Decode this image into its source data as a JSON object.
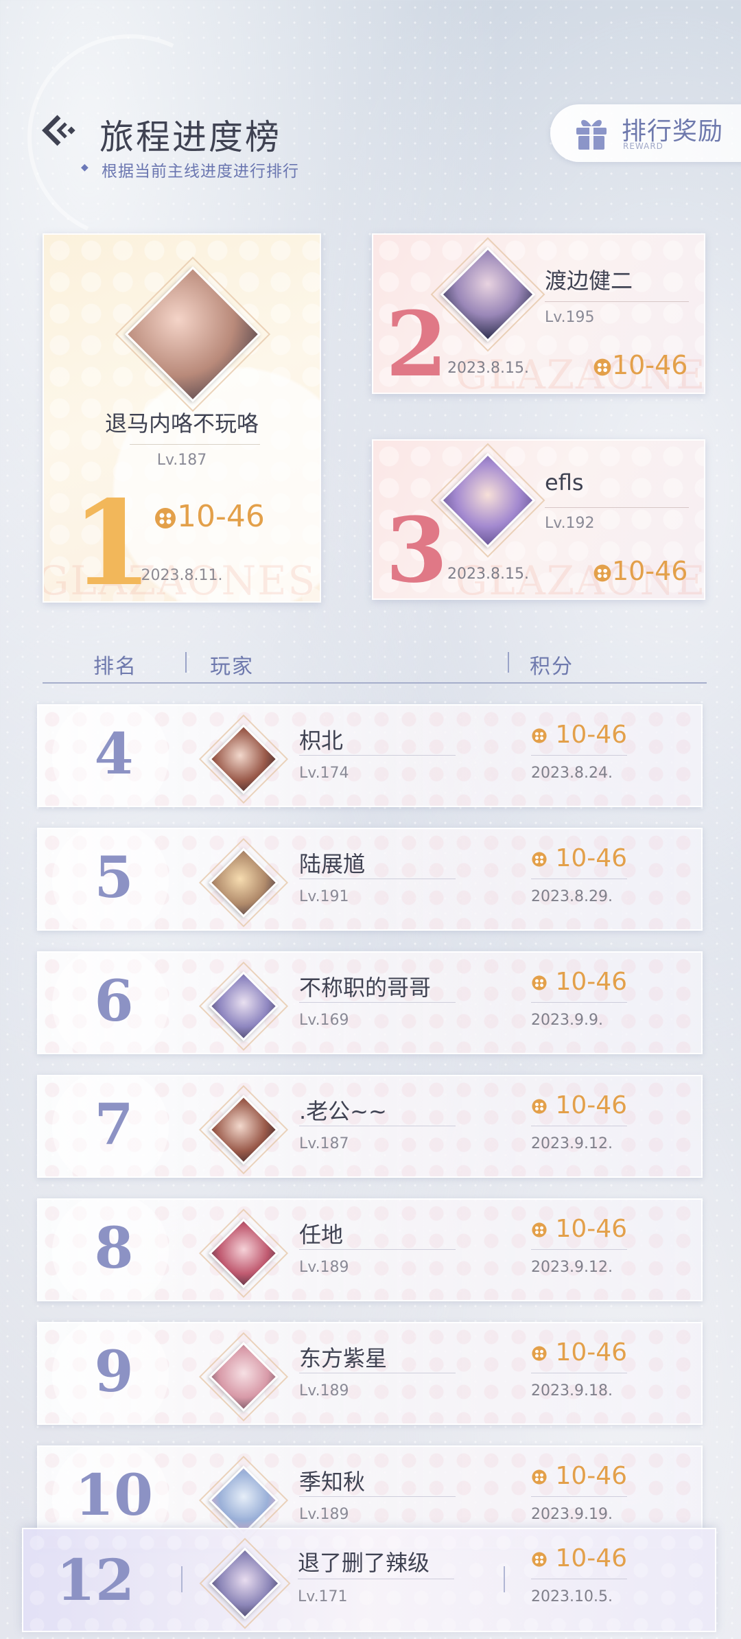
{
  "header": {
    "title": "旅程进度榜",
    "subtitle": "根据当前主线进度进行排行",
    "reward_button": {
      "label": "排行奖励",
      "sublabel": "REWARD"
    }
  },
  "colors": {
    "score": "#e3a04a",
    "rank_top1": "#f2b75a",
    "rank_top23": "#e07886",
    "rank_row": "#8c92c4",
    "accent": "#6e79ad"
  },
  "top3": [
    {
      "rank": "1",
      "name": "退马内咯不玩咯",
      "level": "Lv.187",
      "score": "10-46",
      "date": "2023.8.11.",
      "watermark": "GLAZAONES"
    },
    {
      "rank": "2",
      "name": "渡边健二",
      "level": "Lv.195",
      "score": "10-46",
      "date": "2023.8.15.",
      "watermark": "GLAZAONES"
    },
    {
      "rank": "3",
      "name": "efls",
      "level": "Lv.192",
      "score": "10-46",
      "date": "2023.8.15.",
      "watermark": "GLAZAONES"
    }
  ],
  "table_header": {
    "rank": "排名",
    "player": "玩家",
    "score": "积分"
  },
  "rows": [
    {
      "rank": "4",
      "name": "枳北",
      "level": "Lv.174",
      "score": "10-46",
      "date": "2023.8.24."
    },
    {
      "rank": "5",
      "name": "陆展馗",
      "level": "Lv.191",
      "score": "10-46",
      "date": "2023.8.29."
    },
    {
      "rank": "6",
      "name": "不称职的哥哥",
      "level": "Lv.169",
      "score": "10-46",
      "date": "2023.9.9."
    },
    {
      "rank": "7",
      "name": ".老公~~",
      "level": "Lv.187",
      "score": "10-46",
      "date": "2023.9.12."
    },
    {
      "rank": "8",
      "name": "任地",
      "level": "Lv.189",
      "score": "10-46",
      "date": "2023.9.12."
    },
    {
      "rank": "9",
      "name": "东方紫星",
      "level": "Lv.189",
      "score": "10-46",
      "date": "2023.9.18."
    },
    {
      "rank": "10",
      "name": "季知秋",
      "level": "Lv.189",
      "score": "10-46",
      "date": "2023.9.19."
    }
  ],
  "self_row": {
    "rank": "12",
    "name": "退了删了辣级",
    "level": "Lv.171",
    "score": "10-46",
    "date": "2023.10.5."
  },
  "icons": {
    "back": "back-arrow-icon",
    "reward": "gift-icon",
    "score": "coin-icon",
    "avatar": "avatar-portrait"
  }
}
